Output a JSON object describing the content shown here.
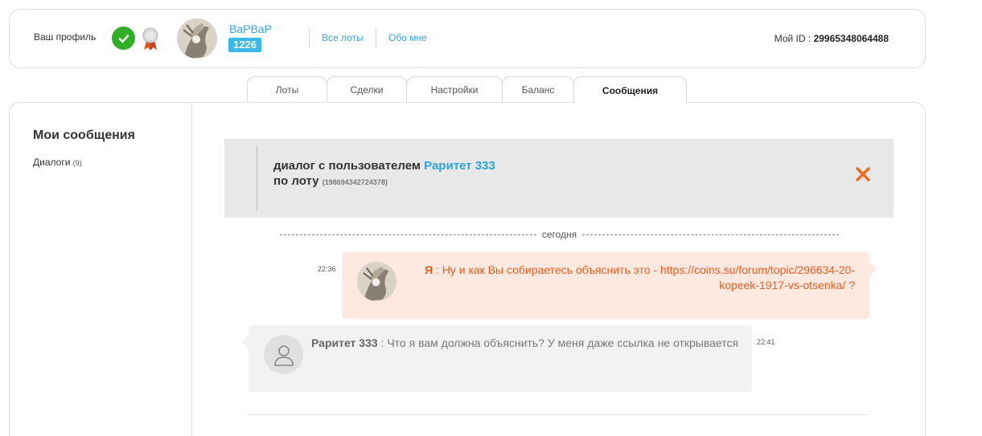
{
  "profile": {
    "label": "Ваш профиль",
    "username": "BaPBaP",
    "rating": "1226",
    "links": [
      "Все лоты",
      "Обо мне"
    ],
    "my_id_label": "Мой ID :",
    "my_id": "29965348064488"
  },
  "tabs": [
    {
      "label": "Лоты"
    },
    {
      "label": "Сделки"
    },
    {
      "label": "Настройки"
    },
    {
      "label": "Баланс"
    },
    {
      "label": "Сообщения"
    }
  ],
  "sidebar": {
    "title": "Мои сообщения",
    "dialogs_label": "Диалоги",
    "dialogs_count": "(9)"
  },
  "dialog": {
    "prefix": "диалог с пользователем",
    "partner": "Раритет 333",
    "lot_prefix": "по лоту",
    "lot_id": "(198694342724378)"
  },
  "date_separator": "сегодня",
  "messages": [
    {
      "author": "Я",
      "text": " : Ну и как Вы собираетесь объяснить это - https://coins.su/forum/topic/296634-20-kopeek-1917-vs-otsenka/ ?",
      "time": "22:36"
    },
    {
      "author": "Раритет 333",
      "text": " : Что я вам должна объяснить? У меня даже ссылка не открывается",
      "time": "22:41"
    }
  ],
  "colors": {
    "accent": "#3aa3dc",
    "verified": "#31b027",
    "own_message_bg": "#fde9e0",
    "own_message_text": "#e85f1f",
    "close_icon": "#f06a1e"
  }
}
